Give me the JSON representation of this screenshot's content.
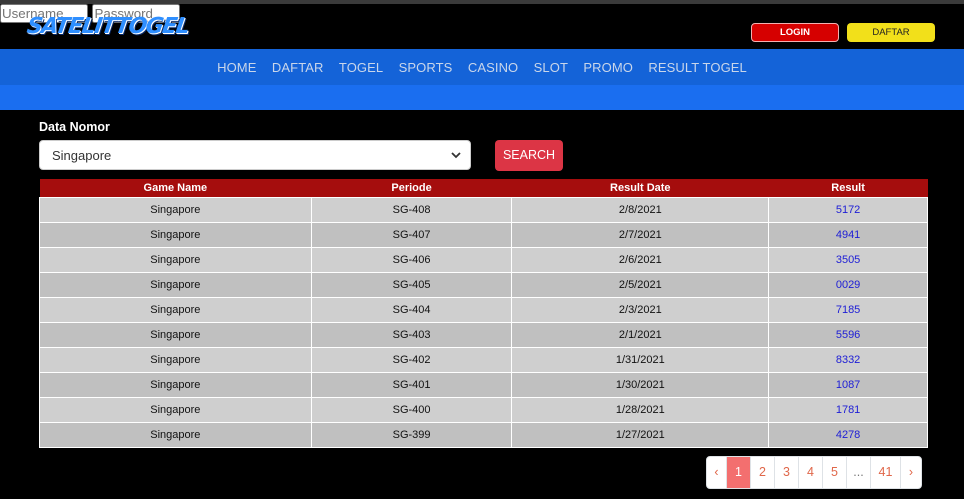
{
  "header": {
    "logo": "SATELITTOGEL",
    "username_placeholder": "Username",
    "password_placeholder": "Password",
    "login_label": "LOGIN",
    "daftar_label": "DAFTAR"
  },
  "nav": [
    "HOME",
    "DAFTAR",
    "TOGEL",
    "SPORTS",
    "CASINO",
    "SLOT",
    "PROMO",
    "RESULT TOGEL"
  ],
  "filter": {
    "label": "Data Nomor",
    "selected": "Singapore",
    "search_label": "SEARCH"
  },
  "table": {
    "columns": [
      "Game Name",
      "Periode",
      "Result Date",
      "Result"
    ],
    "rows": [
      [
        "Singapore",
        "SG-408",
        "2/8/2021",
        "5172"
      ],
      [
        "Singapore",
        "SG-407",
        "2/7/2021",
        "4941"
      ],
      [
        "Singapore",
        "SG-406",
        "2/6/2021",
        "3505"
      ],
      [
        "Singapore",
        "SG-405",
        "2/5/2021",
        "0029"
      ],
      [
        "Singapore",
        "SG-404",
        "2/3/2021",
        "7185"
      ],
      [
        "Singapore",
        "SG-403",
        "2/1/2021",
        "5596"
      ],
      [
        "Singapore",
        "SG-402",
        "1/31/2021",
        "8332"
      ],
      [
        "Singapore",
        "SG-401",
        "1/30/2021",
        "1087"
      ],
      [
        "Singapore",
        "SG-400",
        "1/28/2021",
        "1781"
      ],
      [
        "Singapore",
        "SG-399",
        "1/27/2021",
        "4278"
      ]
    ]
  },
  "pagination": {
    "prev": "‹",
    "pages": [
      "1",
      "2",
      "3",
      "4",
      "5",
      "...",
      "41"
    ],
    "current": "1",
    "next": "›"
  },
  "colors": {
    "nav_bg": "#1463d8",
    "header_accent": "#a50d0d",
    "login": "#d60000",
    "daftar": "#f2e01a",
    "search": "#dc3545"
  }
}
